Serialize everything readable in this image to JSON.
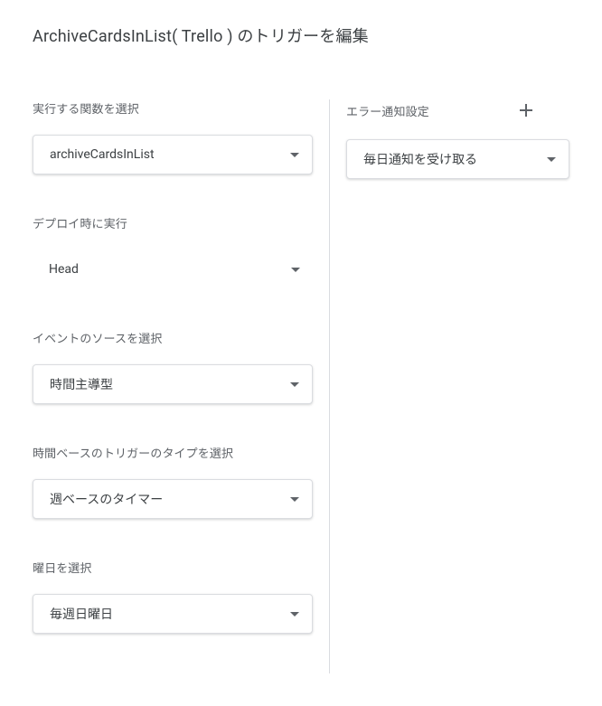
{
  "title": "ArchiveCardsInList( Trello ) のトリガーを編集",
  "left": {
    "function_label": "実行する関数を選択",
    "function_value": "archiveCardsInList",
    "deploy_label": "デプロイ時に実行",
    "deploy_value": "Head",
    "source_label": "イベントのソースを選択",
    "source_value": "時間主導型",
    "timer_type_label": "時間ベースのトリガーのタイプを選択",
    "timer_type_value": "週ベースのタイマー",
    "day_label": "曜日を選択",
    "day_value": "毎週日曜日"
  },
  "right": {
    "error_label": "エラー通知設定",
    "error_value": "毎日通知を受け取る"
  }
}
